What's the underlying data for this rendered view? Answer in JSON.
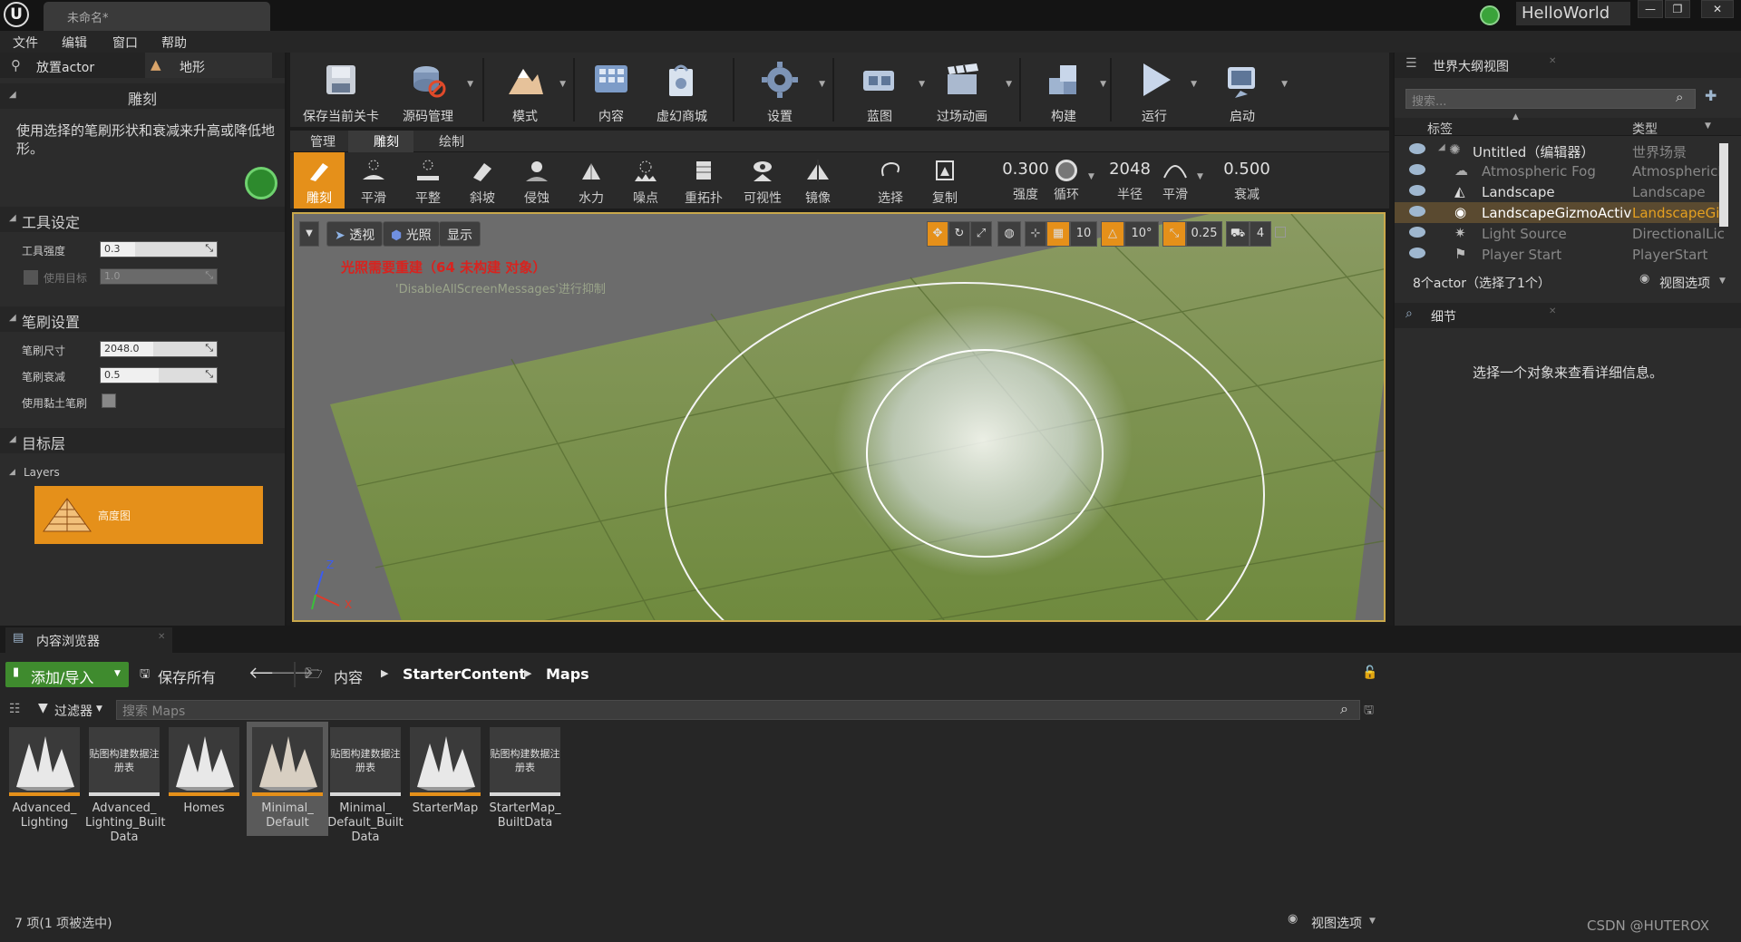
{
  "window": {
    "doc_tab": "未命名*",
    "project_name": "HelloWorld",
    "controls": [
      "—",
      "❐",
      "✕"
    ]
  },
  "menu": [
    "文件",
    "编辑",
    "窗口",
    "帮助"
  ],
  "left_tabs": {
    "place_actor": "放置actor",
    "landscape": "地形"
  },
  "sculpt_section": {
    "title": "雕刻",
    "description": "使用选择的笔刷形状和衰减来升高或降低地形。"
  },
  "tool_settings": {
    "title": "工具设定",
    "strength_label": "工具强度",
    "strength_value": "0.3",
    "strength_fraction": 0.3,
    "target_label": "使用目标",
    "target_value": "1.0"
  },
  "brush_settings": {
    "title": "笔刷设置",
    "size_label": "笔刷尺寸",
    "size_value": "2048.0",
    "size_fraction": 0.45,
    "falloff_label": "笔刷衰减",
    "falloff_value": "0.5",
    "falloff_fraction": 0.5,
    "clay_label": "使用黏土笔刷"
  },
  "target_layers": {
    "title": "目标层",
    "layers_label": "Layers",
    "heightmap_label": "高度图"
  },
  "toolbar": {
    "items": [
      "保存当前关卡",
      "源码管理",
      "模式",
      "内容",
      "虚幻商城",
      "设置",
      "蓝图",
      "过场动画",
      "构建",
      "运行",
      "启动"
    ]
  },
  "mode_tabs": [
    "管理",
    "雕刻",
    "绘制"
  ],
  "sculpt_tools": [
    "雕刻",
    "平滑",
    "平整",
    "斜坡",
    "侵蚀",
    "水力",
    "噪点",
    "重拓扑",
    "可视性",
    "镜像",
    "选择",
    "复制"
  ],
  "brush_params": {
    "strength_value": "0.300",
    "strength_label": "强度",
    "loop_label": "循环",
    "radius_value": "2048",
    "radius_label": "半径",
    "smooth_label": "平滑",
    "falloff_value": "0.500",
    "falloff_label": "衰减"
  },
  "viewport": {
    "perspective": "透视",
    "lit": "光照",
    "show": "显示",
    "grid_snap": "10",
    "rot_snap": "10°",
    "scale_snap": "0.25",
    "cam_speed": "4",
    "warning_main": "光照需要重建（64 未构建 对象）",
    "warning_sub": "'DisableAllScreenMessages'进行抑制",
    "axis_z": "Z",
    "axis_x": "X"
  },
  "outliner": {
    "title": "世界大纲视图",
    "search_placeholder": "搜索...",
    "col_label": "标签",
    "col_type": "类型",
    "rows": [
      {
        "label": "Untitled（编辑器）",
        "type": "世界场景"
      },
      {
        "label": "Atmospheric Fog",
        "type": "AtmosphericF"
      },
      {
        "label": "Landscape",
        "type": "Landscape"
      },
      {
        "label": "LandscapeGizmoActiveA",
        "type": "LandscapeGi"
      },
      {
        "label": "Light Source",
        "type": "DirectionalLic"
      },
      {
        "label": "Player Start",
        "type": "PlayerStart"
      }
    ],
    "status": "8个actor（选择了1个）",
    "view_options": "视图选项"
  },
  "details": {
    "title": "细节",
    "empty_msg": "选择一个对象来查看详细信息。"
  },
  "content_browser": {
    "title": "内容浏览器",
    "add_import": "添加/导入",
    "save_all": "保存所有",
    "path": [
      "内容",
      "StarterContent",
      "Maps"
    ],
    "filters": "过滤器",
    "search_placeholder": "搜索 Maps",
    "assets": [
      {
        "name": "Advanced_ Lighting",
        "kind": "map"
      },
      {
        "name": "Advanced_ Lighting_Built Data",
        "kind": "registry"
      },
      {
        "name": "Homes",
        "kind": "map"
      },
      {
        "name": "Minimal_ Default",
        "kind": "map"
      },
      {
        "name": "Minimal_ Default_Built Data",
        "kind": "registry"
      },
      {
        "name": "StarterMap",
        "kind": "map"
      },
      {
        "name": "StarterMap_ BuiltData",
        "kind": "registry"
      }
    ],
    "registry_thumb_text": "贴图构建数据注册表",
    "status": "7 项(1 项被选中)",
    "view_options": "视图选项"
  },
  "watermark": "CSDN @HUTEROX"
}
